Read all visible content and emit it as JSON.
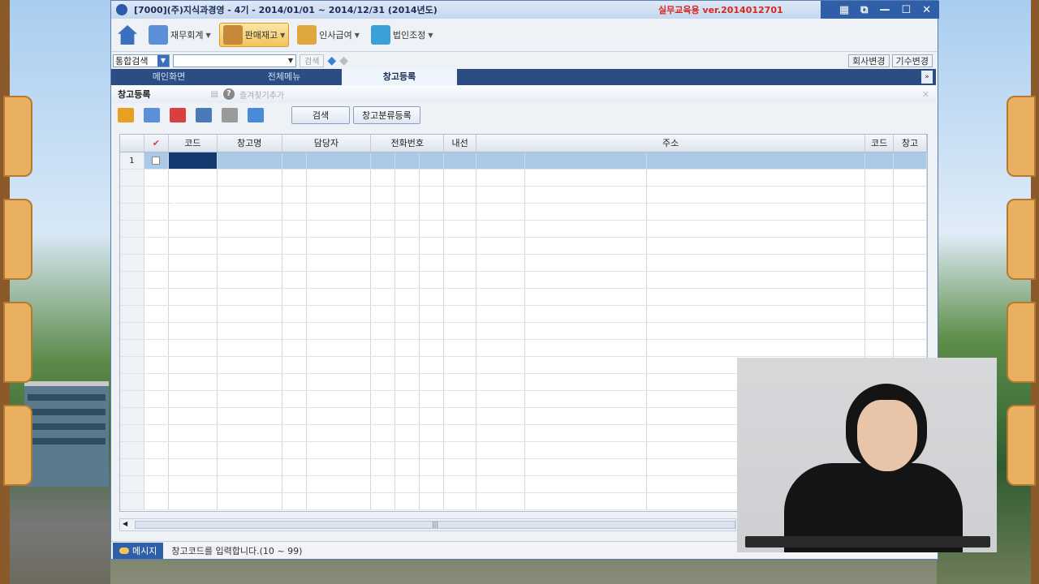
{
  "window": {
    "title": "[7000](주)지식과경영 - 4기 - 2014/01/01 ~ 2014/12/31 (2014년도)",
    "edition": "실무교육용  ver.2014012701"
  },
  "menubar": {
    "items": [
      {
        "label": "재무회계",
        "icon": "ledger-icon",
        "color": "#3a6fc0"
      },
      {
        "label": "판매재고",
        "icon": "box-icon",
        "color": "#c8883a",
        "active": true
      },
      {
        "label": "인사급여",
        "icon": "people-icon",
        "color": "#e0a640"
      },
      {
        "label": "법인조정",
        "icon": "chart-icon",
        "color": "#3aa0d8"
      }
    ]
  },
  "searchbar": {
    "combo_label": "통합검색",
    "search_button": "검색",
    "right_buttons": [
      "회사변경",
      "기수변경"
    ]
  },
  "tabs": [
    "메인화면",
    "전체메뉴",
    "창고등록"
  ],
  "page": {
    "title": "창고등록",
    "help": "?",
    "favorite": "즐겨찾기추가"
  },
  "toolbar": {
    "search_button": "검색",
    "category_button": "창고분류등록"
  },
  "grid": {
    "headers": [
      "",
      "",
      "코드",
      "창고명",
      "담당자",
      "전화번호",
      "내선",
      "주소",
      "코드",
      "창고"
    ],
    "first_row_number": "1"
  },
  "status": {
    "label": "메시지",
    "text": "창고코드를 입력합니다.(10 ~ 99)"
  }
}
